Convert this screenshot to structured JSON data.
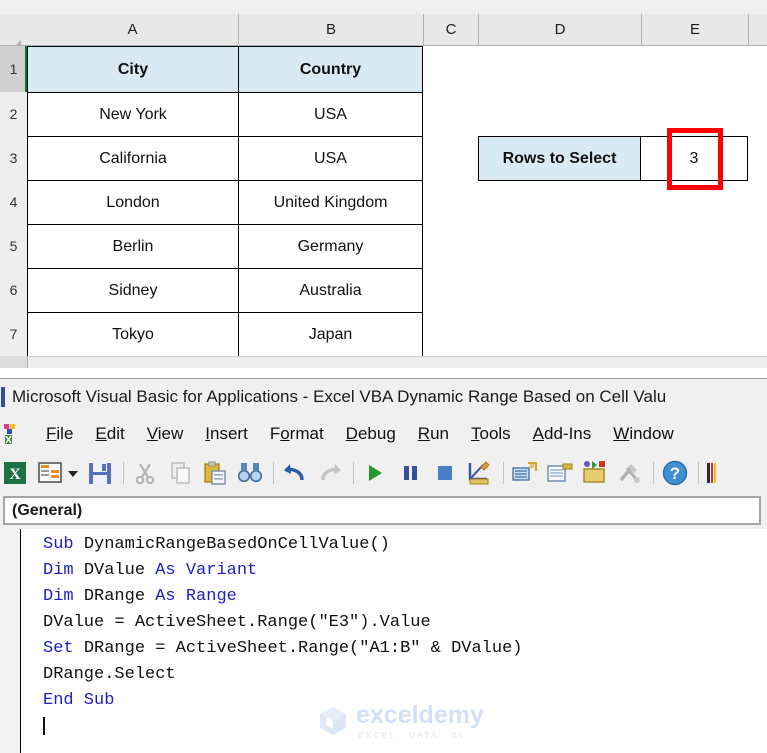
{
  "spreadsheet": {
    "column_headers": [
      "A",
      "B",
      "C",
      "D",
      "E"
    ],
    "row_headers": [
      "1",
      "2",
      "3",
      "4",
      "5",
      "6",
      "7"
    ],
    "table": {
      "headers": [
        "City",
        "Country"
      ],
      "rows": [
        [
          "New York",
          "USA"
        ],
        [
          "California",
          "USA"
        ],
        [
          "London",
          "United Kingdom"
        ],
        [
          "Berlin",
          "Germany"
        ],
        [
          "Sidney",
          "Australia"
        ],
        [
          "Tokyo",
          "Japan"
        ]
      ]
    },
    "input_panel": {
      "label": "Rows to Select",
      "value": "3"
    },
    "colors": {
      "header_fill": "#daeaf5",
      "highlight_box": "#ff0000",
      "selection_accent": "#15743a"
    }
  },
  "vbe": {
    "title": "Microsoft Visual Basic for Applications - Excel VBA Dynamic Range Based on Cell Valu",
    "menu": [
      {
        "label": "File",
        "accel": "F"
      },
      {
        "label": "Edit",
        "accel": "E"
      },
      {
        "label": "View",
        "accel": "V"
      },
      {
        "label": "Insert",
        "accel": "I"
      },
      {
        "label": "Format",
        "accel": "o"
      },
      {
        "label": "Debug",
        "accel": "D"
      },
      {
        "label": "Run",
        "accel": "R"
      },
      {
        "label": "Tools",
        "accel": "T"
      },
      {
        "label": "Add-Ins",
        "accel": "A"
      },
      {
        "label": "Window",
        "accel": "W"
      }
    ],
    "toolbar_icons": [
      "view-excel-icon",
      "dropdown-arrow-icon",
      "save-icon",
      "cut-icon",
      "copy-icon",
      "paste-icon",
      "find-icon",
      "undo-icon",
      "redo-icon",
      "run-icon",
      "break-icon",
      "reset-icon",
      "design-mode-icon",
      "project-explorer-icon",
      "properties-window-icon",
      "object-browser-icon",
      "toolbox-icon",
      "help-icon"
    ],
    "procedure_selector": "(General)",
    "code_lines": [
      [
        {
          "t": "Sub ",
          "k": true
        },
        {
          "t": "DynamicRangeBasedOnCellValue()",
          "k": false
        }
      ],
      [
        {
          "t": "Dim ",
          "k": true
        },
        {
          "t": "DValue ",
          "k": false
        },
        {
          "t": "As Variant",
          "k": true
        }
      ],
      [
        {
          "t": "Dim ",
          "k": true
        },
        {
          "t": "DRange ",
          "k": false
        },
        {
          "t": "As Range",
          "k": true
        }
      ],
      [
        {
          "t": "DValue = ActiveSheet.Range(\"E3\").Value",
          "k": false
        }
      ],
      [
        {
          "t": "Set ",
          "k": true
        },
        {
          "t": "DRange = ActiveSheet.Range(\"A1:B\" & DValue)",
          "k": false
        }
      ],
      [
        {
          "t": "DRange.Select",
          "k": false
        }
      ],
      [
        {
          "t": "End Sub",
          "k": true
        }
      ]
    ]
  },
  "watermark": {
    "name": "exceldemy",
    "tagline": "EXCEL · DATA · BI"
  }
}
